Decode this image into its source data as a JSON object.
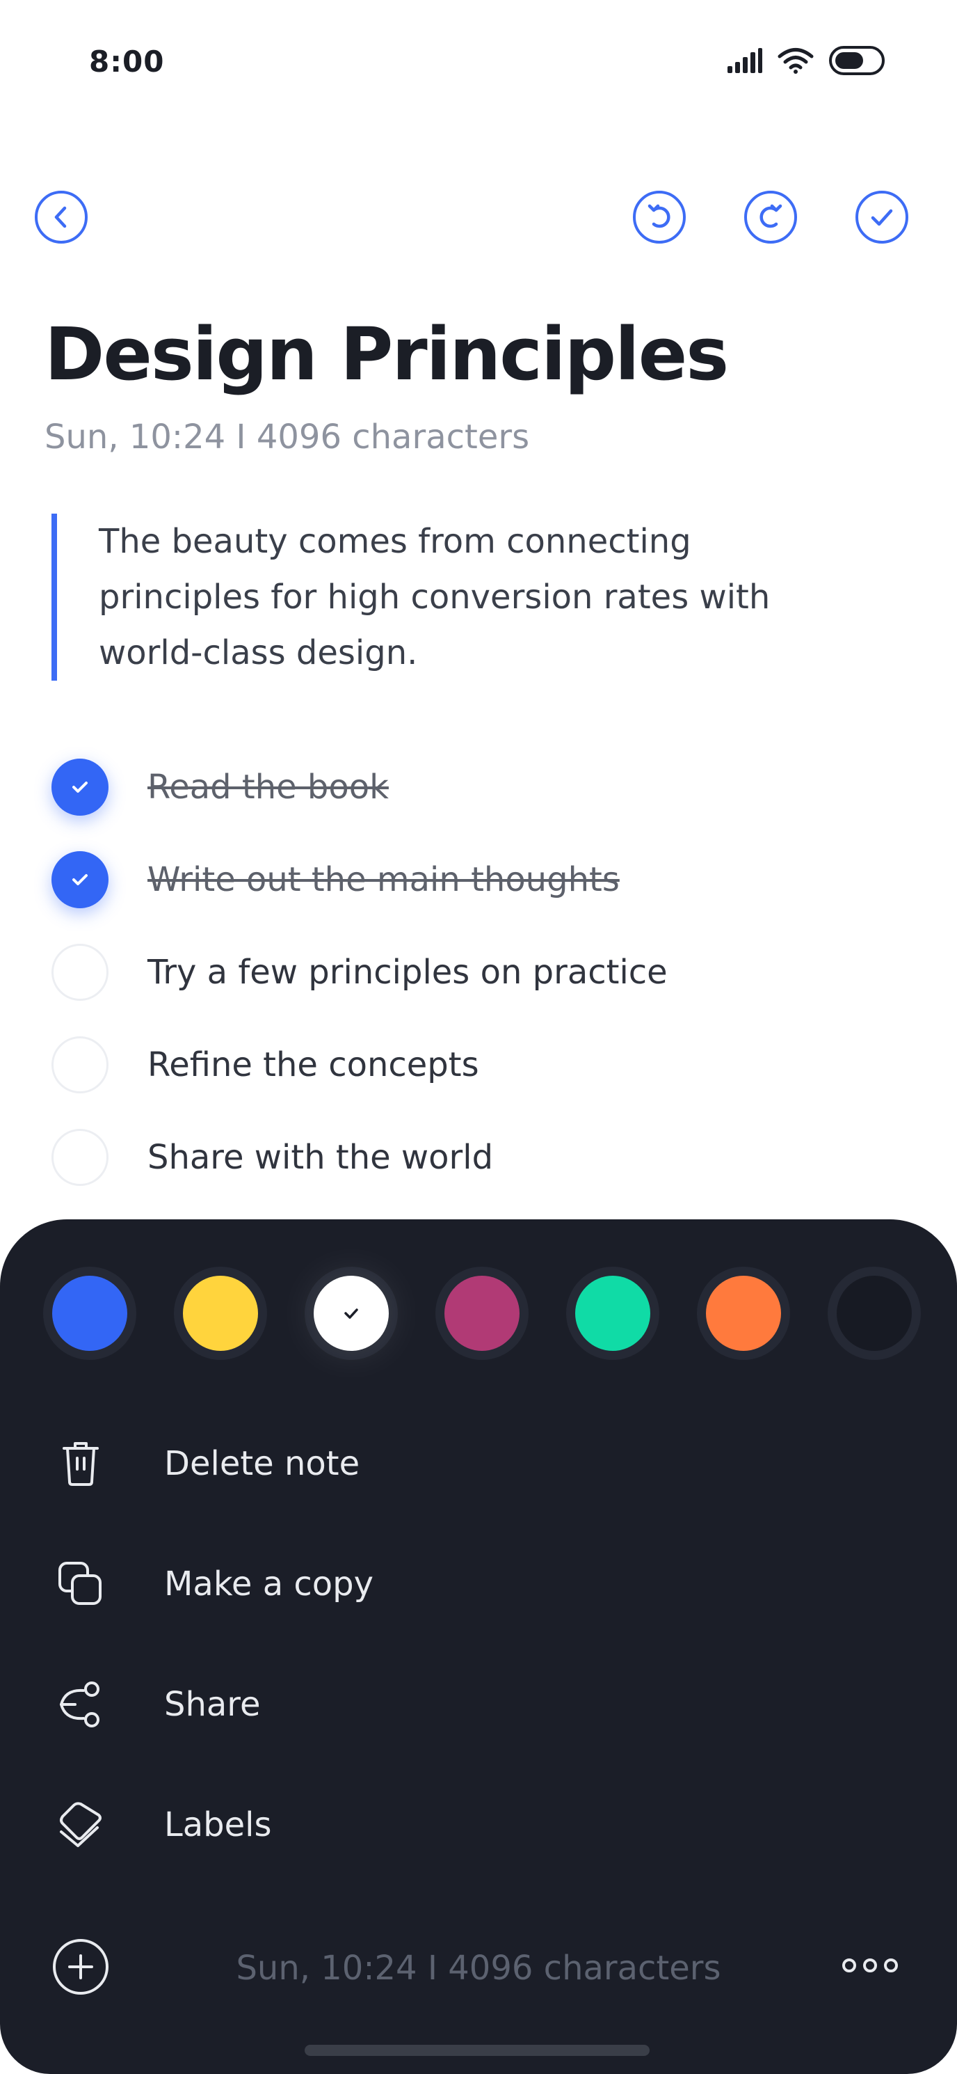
{
  "status_bar": {
    "time": "8:00",
    "icons": [
      "signal-icon",
      "wifi-icon",
      "battery-icon"
    ]
  },
  "toolbar": {
    "icons": [
      "back-icon",
      "undo-icon",
      "redo-icon",
      "done-icon"
    ]
  },
  "note": {
    "title": "Design Principles",
    "meta": "Sun, 10:24  I  4096 characters",
    "quote": "The beauty comes from connecting principles for high conversion rates with world-class design.",
    "checklist": [
      {
        "label": "Read the book",
        "checked": true
      },
      {
        "label": "Write out the main thoughts",
        "checked": true
      },
      {
        "label": "Try a few principles on practice",
        "checked": false
      },
      {
        "label": "Refine the concepts",
        "checked": false
      },
      {
        "label": "Share with the world",
        "checked": false
      }
    ]
  },
  "sheet": {
    "colors": [
      {
        "hex": "#3366f5",
        "selected": false
      },
      {
        "hex": "#ffd43d",
        "selected": false
      },
      {
        "hex": "#ffffff",
        "selected": true
      },
      {
        "hex": "#b13a75",
        "selected": false
      },
      {
        "hex": "#10dba6",
        "selected": false
      },
      {
        "hex": "#ff7a3d",
        "selected": false
      },
      {
        "hex": "#1b1e28",
        "selected": false
      }
    ],
    "menu": [
      {
        "label": "Delete note",
        "icon": "trash-icon"
      },
      {
        "label": "Make a copy",
        "icon": "copy-icon"
      },
      {
        "label": "Share",
        "icon": "share-icon"
      },
      {
        "label": "Labels",
        "icon": "label-icon"
      }
    ],
    "footer_meta": "Sun, 10:24  I  4096 characters",
    "footer_icons": [
      "add-icon",
      "more-icon"
    ]
  },
  "accent": "#3d6cf5"
}
